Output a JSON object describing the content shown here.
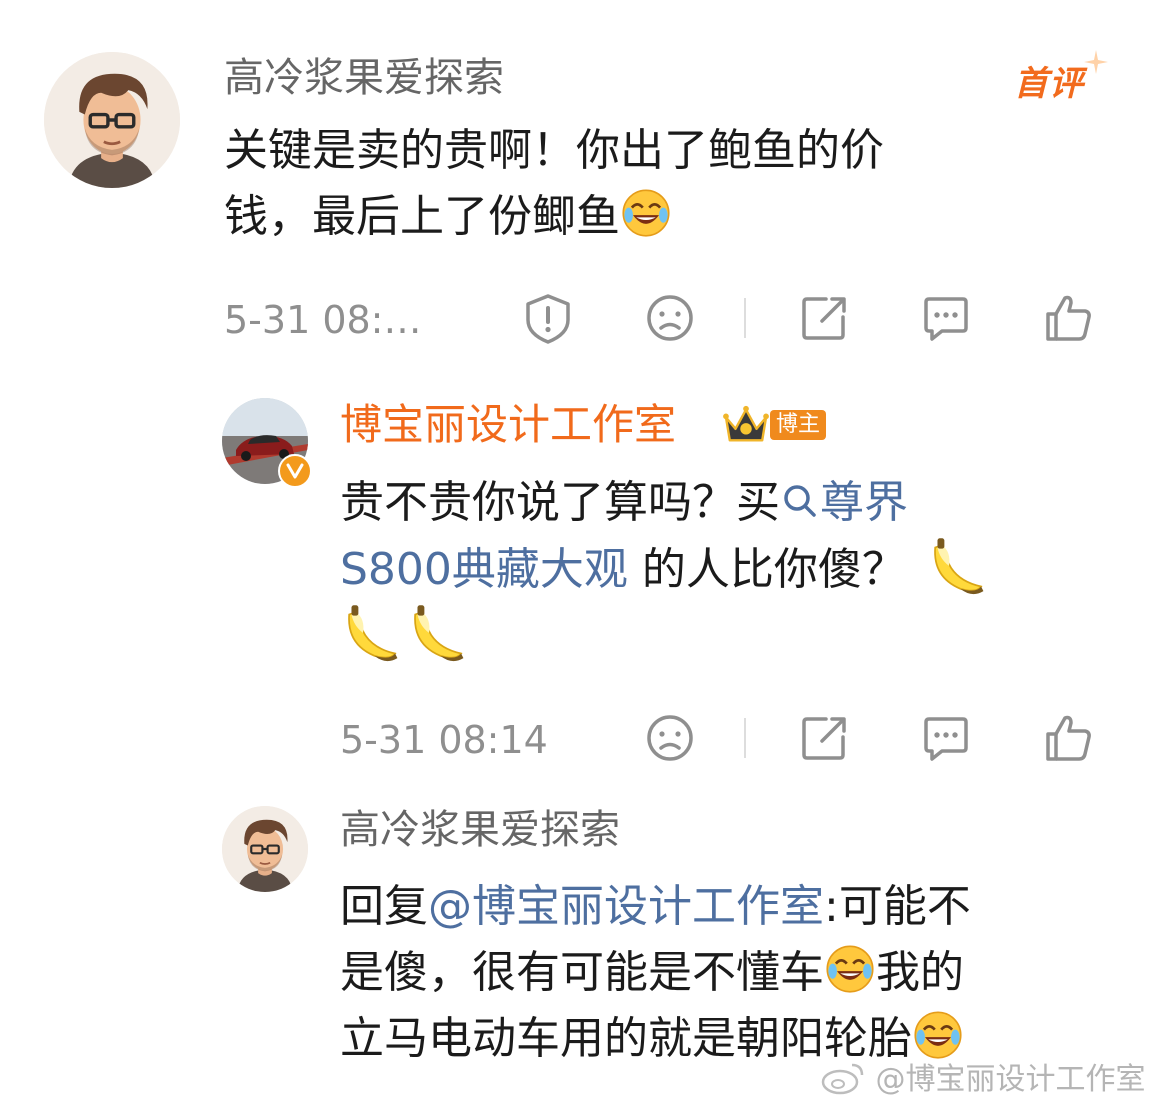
{
  "comments": {
    "main": {
      "username": "高冷浆果爱探索",
      "first_badge": "首评",
      "text_line1": "关键是卖的贵啊！你出了鲍鱼的价",
      "text_line2": "钱，最后上了份鲫鱼",
      "time": "5-31 08:…"
    },
    "reply1": {
      "username": "博宝丽设计工作室",
      "badge_label": "博主",
      "text_a": "贵不贵你说了算吗？买",
      "link_text": "尊界",
      "link_text2": "S800典藏大观",
      "text_b": " 的人比你傻？",
      "time": "5-31 08:14"
    },
    "reply2": {
      "username": "高冷浆果爱探索",
      "prefix": "回复",
      "mention": "@博宝丽设计工作室",
      "text_a": ":可能不",
      "text_b": "是傻，很有可能是不懂车",
      "text_c": "我的",
      "text_d": "立马电动车用的就是朝阳轮胎"
    }
  },
  "icons": [
    "report-icon",
    "dislike-icon",
    "share-icon",
    "comment-icon",
    "like-icon",
    "laugh-cry-emoji",
    "banana-emoji",
    "crown-icon",
    "verified-icon",
    "search-icon"
  ],
  "watermark": "@博宝丽设计工作室",
  "colors": {
    "accent_orange": "#f16a1b",
    "link_blue": "#4e6fa0",
    "icon_gray": "#8f8f8f"
  }
}
